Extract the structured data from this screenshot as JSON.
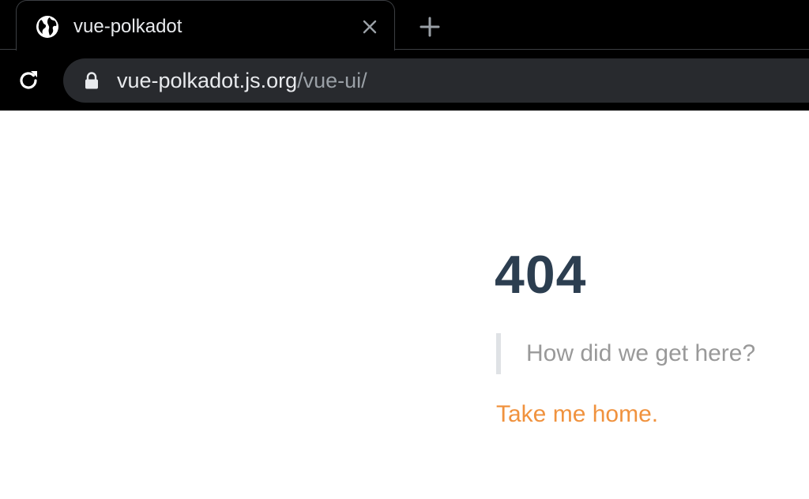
{
  "browser": {
    "tab": {
      "title": "vue-polkadot",
      "favicon": "globe-icon",
      "close_icon": "close-icon"
    },
    "new_tab_icon": "plus-icon",
    "reload_icon": "reload-icon",
    "address_bar": {
      "lock_icon": "lock-icon",
      "host": "vue-polkadot.js.org",
      "path": "/vue-ui/"
    }
  },
  "page": {
    "error_code": "404",
    "message": "How did we get here?",
    "home_link": "Take me home."
  },
  "colors": {
    "chrome_bg": "#000000",
    "omnibox_bg": "#282a2e",
    "heading": "#2c3e50",
    "quote_text": "#999999",
    "quote_border": "#dfe2e5",
    "link": "#f0923e"
  }
}
